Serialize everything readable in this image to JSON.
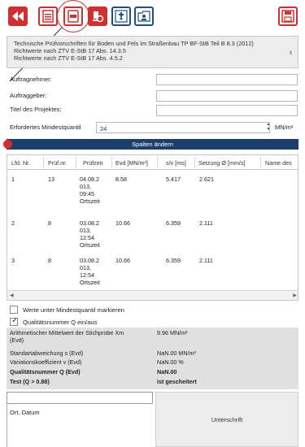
{
  "colors": {
    "accent": "#d32f2f",
    "bar": "#1c3f6e",
    "stats_bg": "#e0e0e0"
  },
  "toolbar": {
    "icons": [
      "rewind-icon",
      "document-list-icon",
      "document-active-icon",
      "machine-icon",
      "add-user-icon",
      "folder-user-icon",
      "save-icon"
    ]
  },
  "select": {
    "lines": [
      "Technische Prüfvorschriften für Boden und Fels im Straßenbau TP BF-StB Teil B 8.3 (2012)",
      "Richtwerte nach ZTV E-StB 17 Abs. 14.3.5",
      "Richtwerte nach ZTV E-StB 17 Abs. 4.5.2"
    ]
  },
  "form": {
    "auftragnehmer": "Auftragnehmer:",
    "auftraggeber": "Auftraggeber:",
    "titel": "Titel des Projektes:",
    "quantil_label": "Erfordertes Mindestquantil",
    "quantil_value": "24",
    "unit": "MN/m²"
  },
  "columns_button": "Spalten ändern",
  "table": {
    "headers": [
      "Lfd. Nr.",
      "Prüf.nr.",
      "Prüfzeit",
      "Evd [MN/m²]",
      "s/v [ms]",
      "Setzung Ø [mm/s]",
      "Name des"
    ],
    "rows": [
      {
        "lfd": "1",
        "pruef": "13",
        "zeit": [
          "04.08.2",
          "013,",
          "09:45",
          "Ortszeit"
        ],
        "evd": "8.58",
        "sv": "5.417",
        "setz": "2.621"
      },
      {
        "lfd": "2",
        "pruef": "8",
        "zeit": [
          "03.08.2",
          "013,",
          "12:54",
          "Ortszeit"
        ],
        "evd": "10.66",
        "sv": "6.359",
        "setz": "2.111"
      },
      {
        "lfd": "3",
        "pruef": "8",
        "zeit": [
          "03.08.2",
          "013,",
          "12:54",
          "Ortszeit"
        ],
        "evd": "10.66",
        "sv": "6.359",
        "setz": "2.111"
      }
    ]
  },
  "checkboxes": {
    "mark_label": "Werte unter Mindestquantil markieren",
    "mark_checked": false,
    "q_label": "Qualitätsnummer Q ein/aus",
    "q_checked": true
  },
  "stats": {
    "mean_label_1": "Arithmetischer Mittelwert der Stichprobe Xm",
    "mean_label_2": "(Evd)",
    "mean_value": "9.96 MN/m²",
    "std_label": "Standartabweichung s (Evd)",
    "std_value": "NaN.00 MN/m²",
    "var_label": "Variationskoeffizient v (Evd)",
    "var_value": "NaN.00 %",
    "q_label": "Qualitätsnummer Q (Evd)",
    "q_value": "NaN.00",
    "test_label": "Test (Q > 0.88)",
    "test_value": "ist gescheitert"
  },
  "footer": {
    "place_label": "Ort, Datum",
    "sign_label": "Unterschrift"
  }
}
